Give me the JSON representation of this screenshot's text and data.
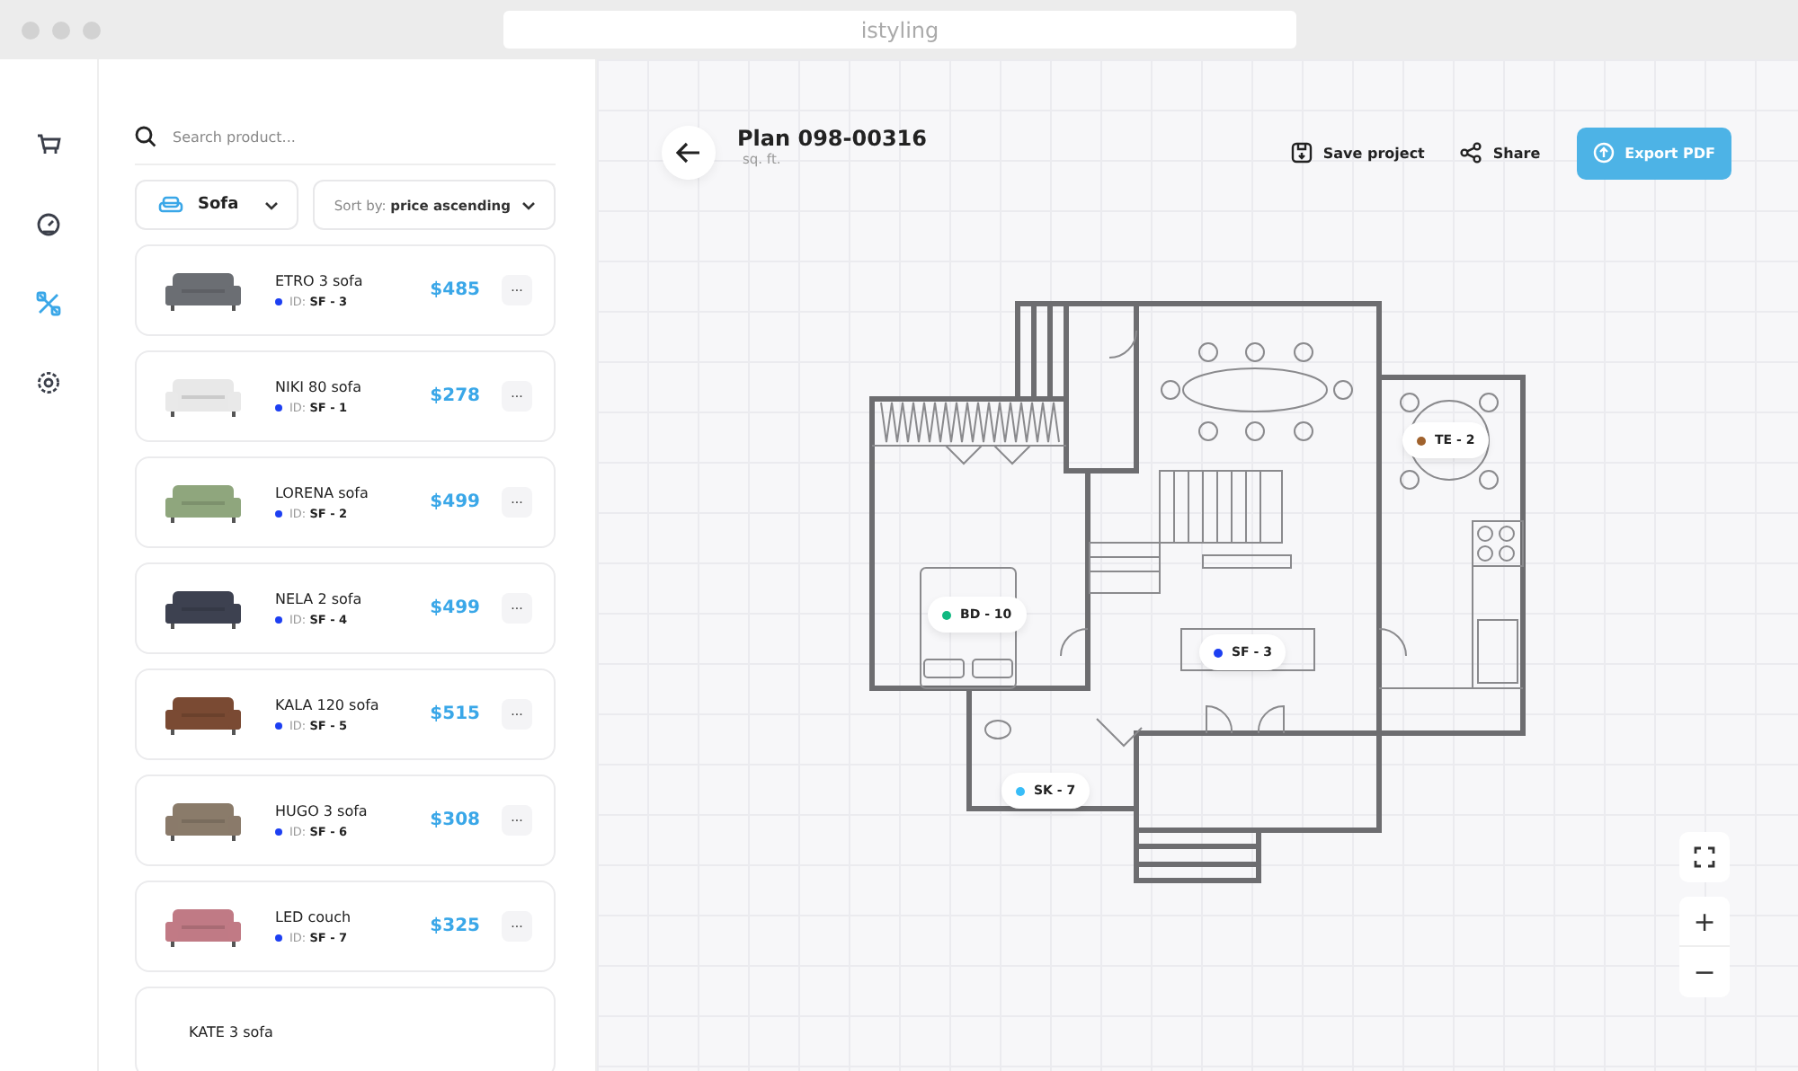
{
  "browser": {
    "address": "istyling"
  },
  "nav": [
    {
      "selected": false
    },
    {
      "selected": false
    },
    {
      "selected": true
    },
    {
      "selected": false
    }
  ],
  "search": {
    "placeholder": "Search product..."
  },
  "category": {
    "value": "Sofa"
  },
  "sort": {
    "label": "Sort by:",
    "value": "price ascending"
  },
  "products": [
    {
      "name": "ETRO 3 sofa",
      "id_label": "ID:",
      "id": "SF - 3",
      "price": "$485",
      "menu": "···",
      "kind": "picture"
    },
    {
      "name": "NIKI 80 sofa",
      "id_label": "ID:",
      "id": "SF - 1",
      "price": "$278",
      "menu": "···",
      "kind": "picture"
    },
    {
      "name": "LORENA sofa",
      "id_label": "ID:",
      "id": "SF - 2",
      "price": "$499",
      "menu": "···",
      "kind": "picture"
    },
    {
      "name": "NELA 2 sofa",
      "id_label": "ID:",
      "id": "SF - 4",
      "price": "$499",
      "menu": "···",
      "kind": "picture"
    },
    {
      "name": "KALA 120 sofa",
      "id_label": "ID:",
      "id": "SF - 5",
      "price": "$515",
      "menu": "···",
      "kind": "picture"
    },
    {
      "name": "HUGO 3 sofa",
      "id_label": "ID:",
      "id": "SF - 6",
      "price": "$308",
      "menu": "···",
      "kind": "picture"
    },
    {
      "name": "LED couch",
      "id_label": "ID:",
      "id": "SF - 7",
      "price": "$325",
      "menu": "···",
      "kind": "picture"
    },
    {
      "name": "KATE 3 sofa"
    }
  ],
  "plan": {
    "title": "Plan 098-00316",
    "subtitle": "sq. ft."
  },
  "actions": [
    {
      "label": "Save project",
      "kind": "save"
    },
    {
      "label": "Share",
      "kind": "share"
    },
    {
      "label": "Export PDF",
      "kind": "export"
    }
  ],
  "pins": [
    {
      "label": "TE - 2",
      "color": "#a0622d"
    },
    {
      "label": "BD - 10",
      "color": "#10b981"
    },
    {
      "label": "SF - 3",
      "color": "#1d3ff2"
    },
    {
      "label": "SK - 7",
      "color": "#38bdf8"
    }
  ],
  "zoom": {
    "in": "+",
    "out": "−"
  }
}
